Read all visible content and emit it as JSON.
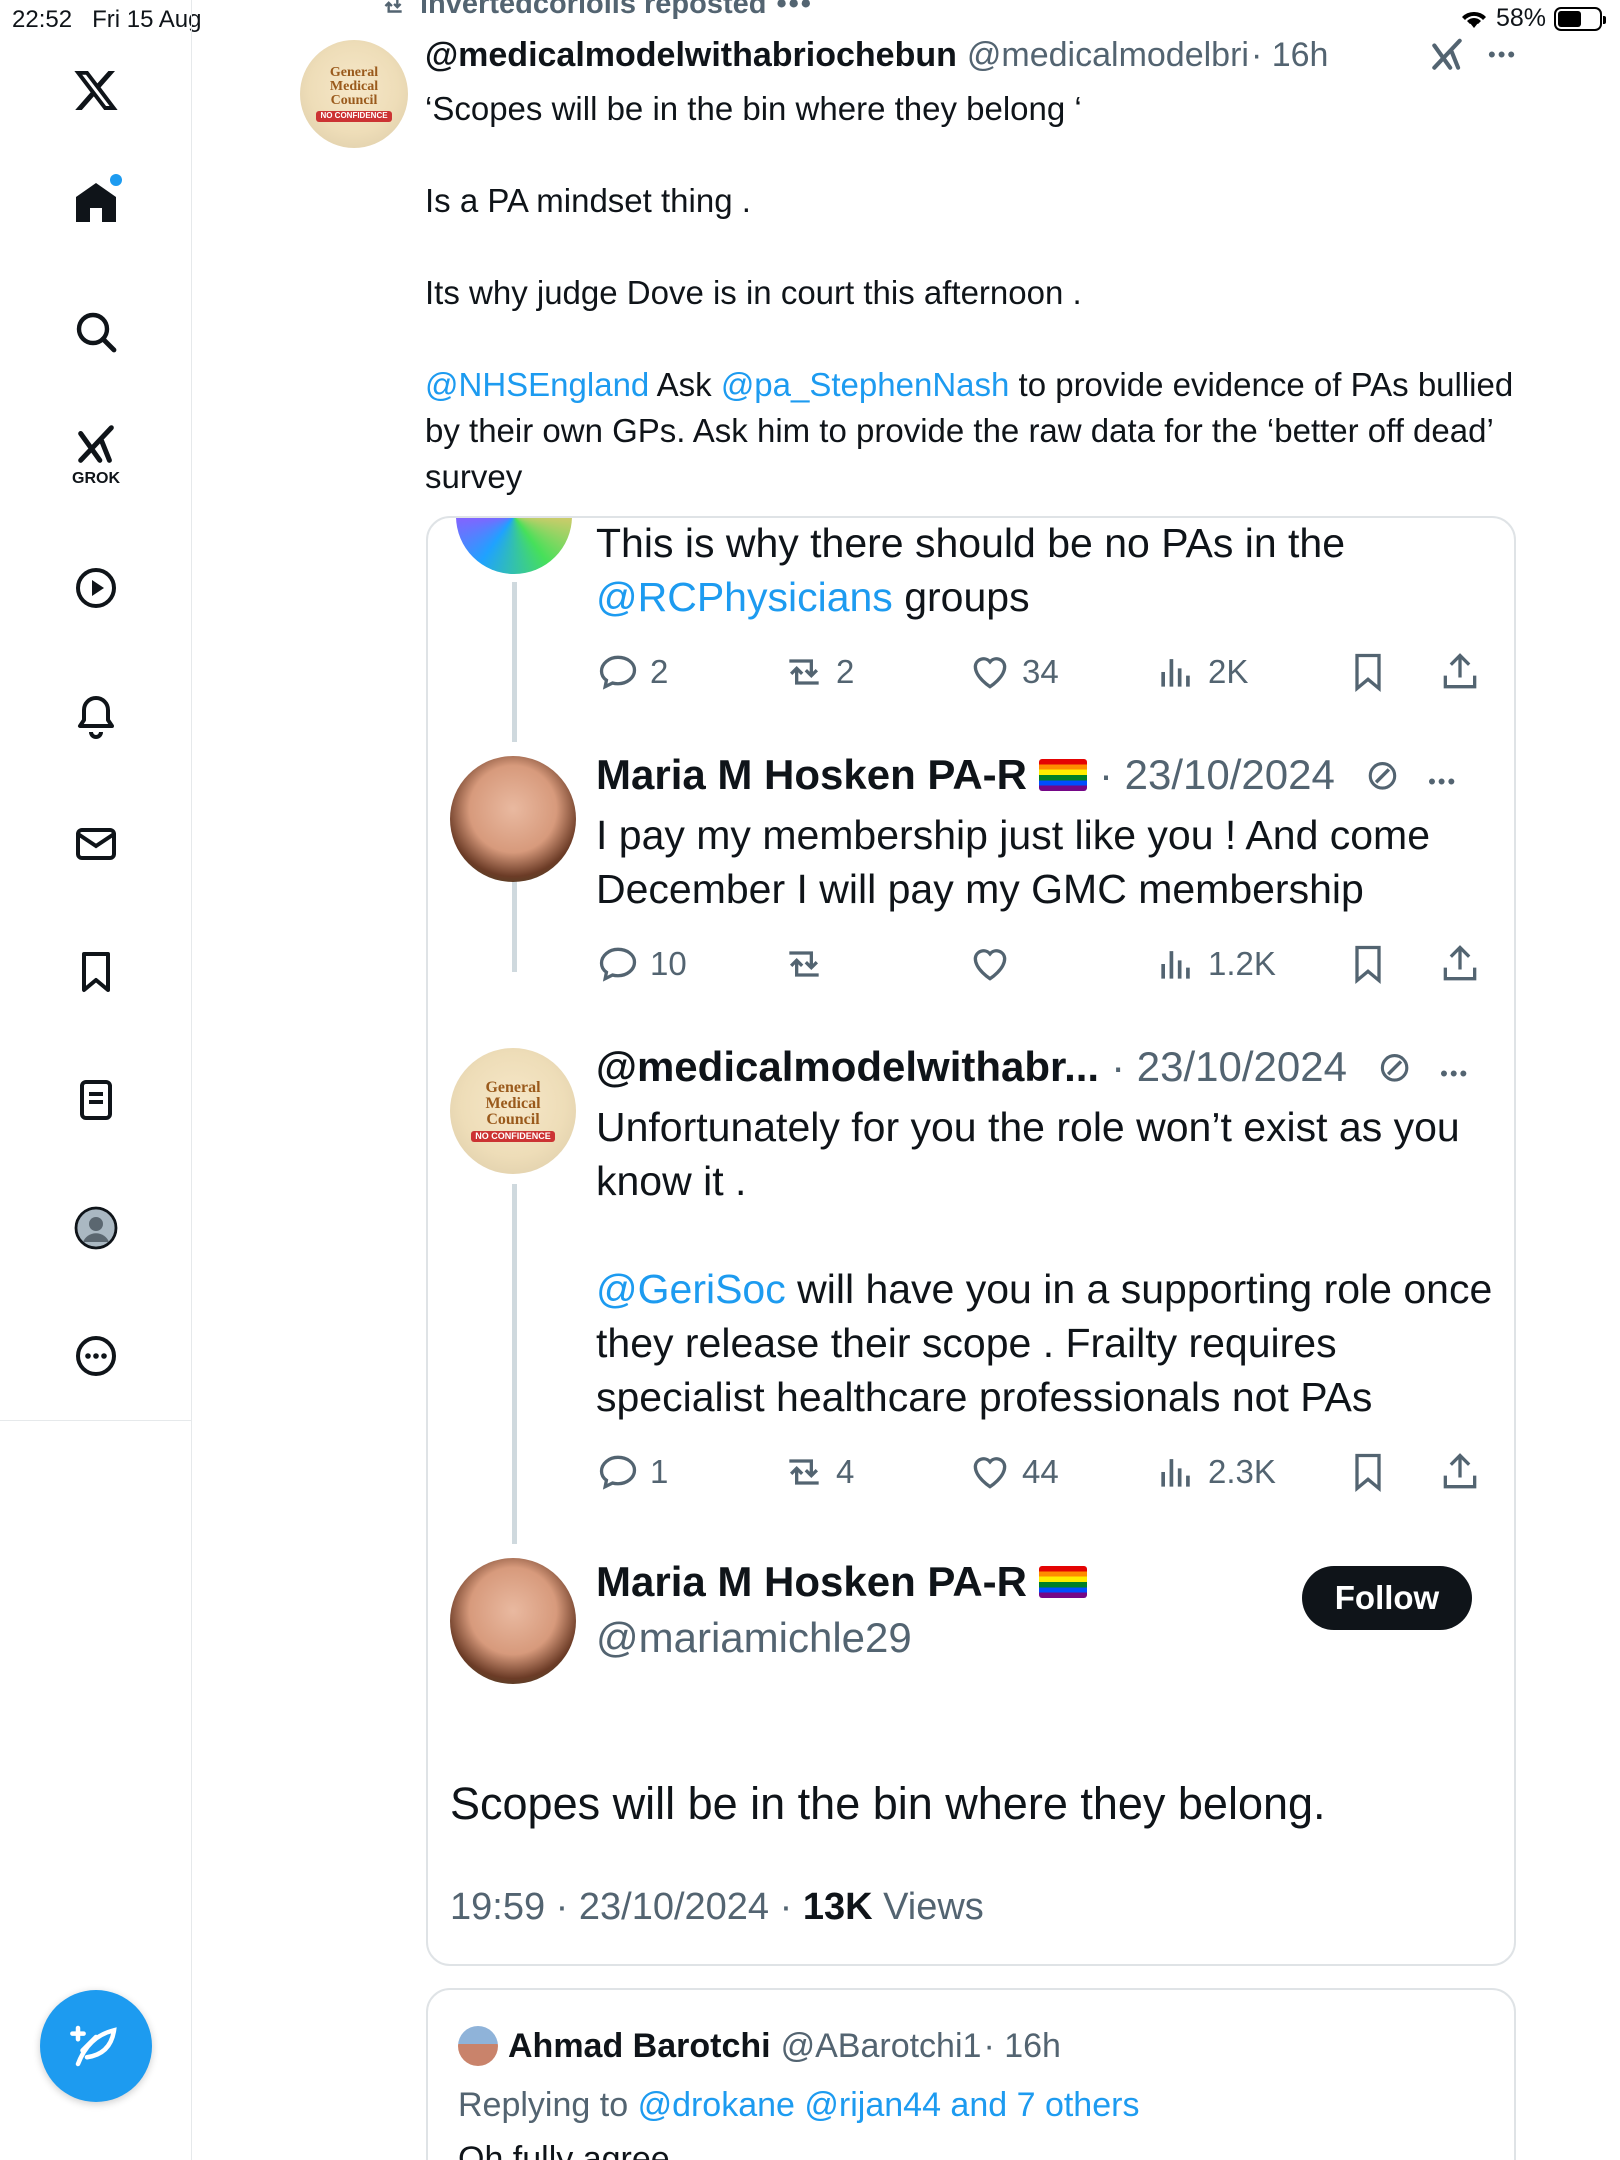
{
  "status_bar": {
    "time": "22:52",
    "date": "Fri 15 Aug",
    "battery": "58%",
    "battery_level": 0.58
  },
  "sidebar": {
    "items": [
      "home",
      "search",
      "grok",
      "videos",
      "notifications",
      "messages",
      "bookmarks",
      "lists",
      "profile",
      "more"
    ],
    "grok_label": "GROK"
  },
  "repost": {
    "label": "invertedcoriolis reposted"
  },
  "tweet": {
    "author_name": "@medicalmodelwithabriochebun",
    "handle": "@medicalmodelbri",
    "age": "· 16h",
    "p1": "‘Scopes will be in the bin where they belong ‘",
    "p2": "Is a PA mindset thing .",
    "p3": "Its why judge Dove is in court this afternoon .",
    "p4_mention1": "@NHSEngland",
    "p4_ask": " Ask ",
    "p4_mention2": "@pa_StephenNash",
    "p4_rest": " to provide evidence of PAs bullied by their own GPs. Ask him to provide the raw data for the  ‘better off dead’ survey"
  },
  "avatar_text": {
    "line1": "General",
    "line2": "Medical",
    "line3": "Council",
    "stamp": "NO CONFIDENCE"
  },
  "quote": {
    "post1": {
      "text_a": "This is why there should be no PAs in the",
      "mention": "@RCPhysicians",
      "text_b": " groups",
      "replies": "2",
      "reposts": "2",
      "likes": "34",
      "views": "2K"
    },
    "post2": {
      "name": "Maria M Hosken PA-R",
      "date": "· 23/10/2024",
      "text": "I pay my membership just like you ! And come December I will pay my GMC membership",
      "replies": "10",
      "reposts": "",
      "likes": "",
      "views": "1.2K"
    },
    "post3": {
      "name": "@medicalmodelwithabr...",
      "date": "· 23/10/2024",
      "text1": "Unfortunately for you the role won’t exist as you know it .",
      "mention": "@GeriSoc",
      "text2": " will have you in a supporting role once they release their scope  . Frailty requires specialist healthcare professionals not PAs",
      "replies": "1",
      "reposts": "4",
      "likes": "44",
      "views": "2.3K"
    },
    "main": {
      "name": "Maria M Hosken PA-R",
      "handle": "@mariamichle29",
      "follow_label": "Follow",
      "text": "Scopes will be in the bin where they belong.",
      "time": "19:59 · 23/10/2024 ·",
      "views_count": "13K",
      "views_label": "Views"
    }
  },
  "reply": {
    "name": "Ahmad Barotchi",
    "handle": "@ABarotchi1",
    "age": "· 16h",
    "replying_label": "Replying to",
    "replying_to": "@drokane @rijan44 and 7 others",
    "text": "Oh fully agree"
  },
  "colors": {
    "accent": "#1d9bf0",
    "text": "#0f1419",
    "muted": "#536471",
    "border": "#dfe3e6"
  }
}
